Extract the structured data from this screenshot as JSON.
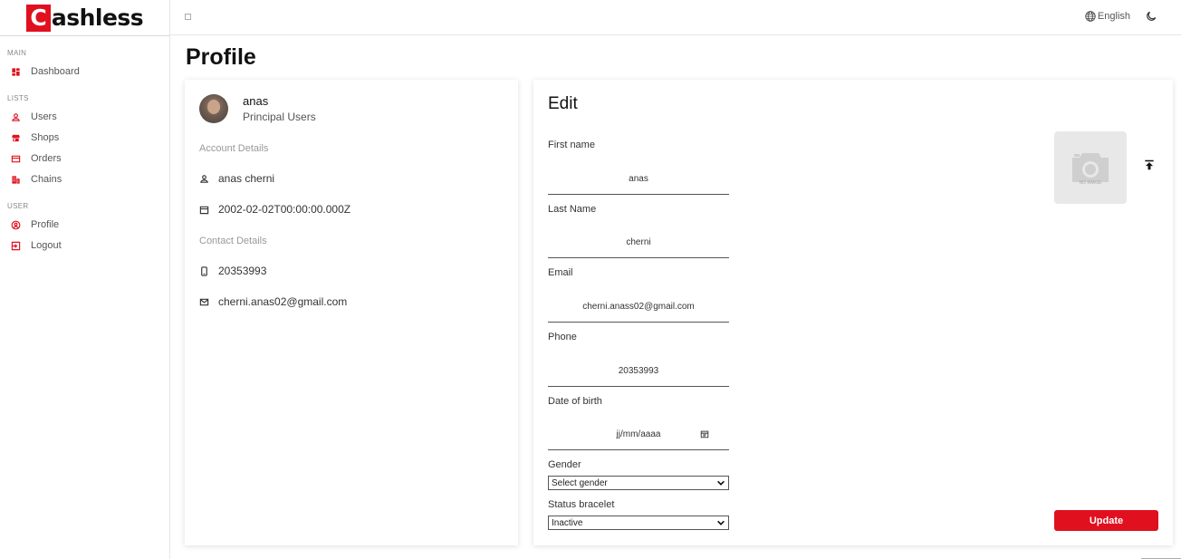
{
  "brand": {
    "logo_letter": "C",
    "logo_rest": "ashless",
    "accent": "#e0101f"
  },
  "sidebar": {
    "sections": [
      {
        "title": "MAIN"
      },
      {
        "title": "LISTS"
      },
      {
        "title": "USER"
      }
    ],
    "items": [
      {
        "label": "Dashboard",
        "icon": "dashboard-icon"
      },
      {
        "label": "Users",
        "icon": "user-icon"
      },
      {
        "label": "Shops",
        "icon": "store-icon"
      },
      {
        "label": "Orders",
        "icon": "credit-card-icon"
      },
      {
        "label": "Chains",
        "icon": "building-icon"
      },
      {
        "label": "Profile",
        "icon": "account-circle-icon"
      },
      {
        "label": "Logout",
        "icon": "logout-icon"
      }
    ]
  },
  "topbar": {
    "language": "English"
  },
  "page": {
    "title": "Profile"
  },
  "profile": {
    "name": "anas",
    "role": "Principal Users",
    "account_heading": "Account Details",
    "full_name": "anas cherni",
    "birth": "2002-02-02T00:00:00.000Z",
    "contact_heading": "Contact Details",
    "phone": "20353993",
    "email": "cherni.anas02@gmail.com"
  },
  "edit": {
    "title": "Edit",
    "fields": [
      {
        "label": "First name",
        "value": "anas"
      },
      {
        "label": "Last Name",
        "value": "cherni"
      },
      {
        "label": "Email",
        "value": "cherni.anass02@gmail.com"
      },
      {
        "label": "Phone",
        "value": "20353993"
      },
      {
        "label": "Date of birth",
        "value": "jj/mm/aaaa"
      }
    ],
    "gender": {
      "label": "Gender",
      "value": "Select gender"
    },
    "status": {
      "label": "Status bracelet",
      "value": "Inactive"
    },
    "no_image": "NO IMAGE",
    "update_label": "Update"
  }
}
